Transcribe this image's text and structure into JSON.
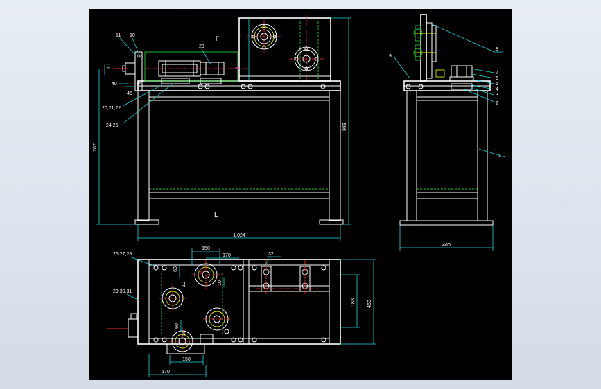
{
  "drawing": {
    "front_view": {
      "part_labels": [
        "11",
        "10",
        "23",
        "40",
        "20,21,22",
        "24,25"
      ],
      "dimensions": {
        "width": "1,024",
        "height_left": "767",
        "height_right": "983",
        "small_1": "10",
        "small_2": "45"
      },
      "section_marks": [
        "Γ",
        "L"
      ]
    },
    "side_view": {
      "part_labels": [
        "8",
        "9",
        "7",
        "6",
        "5",
        "4",
        "3",
        "2",
        "1"
      ],
      "dimensions": {
        "width": "460"
      }
    },
    "top_view": {
      "part_labels": [
        "26,27,28",
        "29,30,31",
        "32"
      ],
      "dimensions": {
        "top_150": "150",
        "top_170": "170",
        "bottom_150": "150",
        "bottom_170": "170",
        "right_183": "183",
        "right_460": "460",
        "small_60": "60",
        "small_60b": "60",
        "small_10": "10",
        "small_10b": "10",
        "small_55": "55"
      }
    }
  },
  "colors": {
    "background": "#000000",
    "outline": "#ffffff",
    "dimension": "#1ad7e0",
    "hidden": "#22cc33",
    "center": "#ff2a2a",
    "accent": "#e6e600"
  }
}
